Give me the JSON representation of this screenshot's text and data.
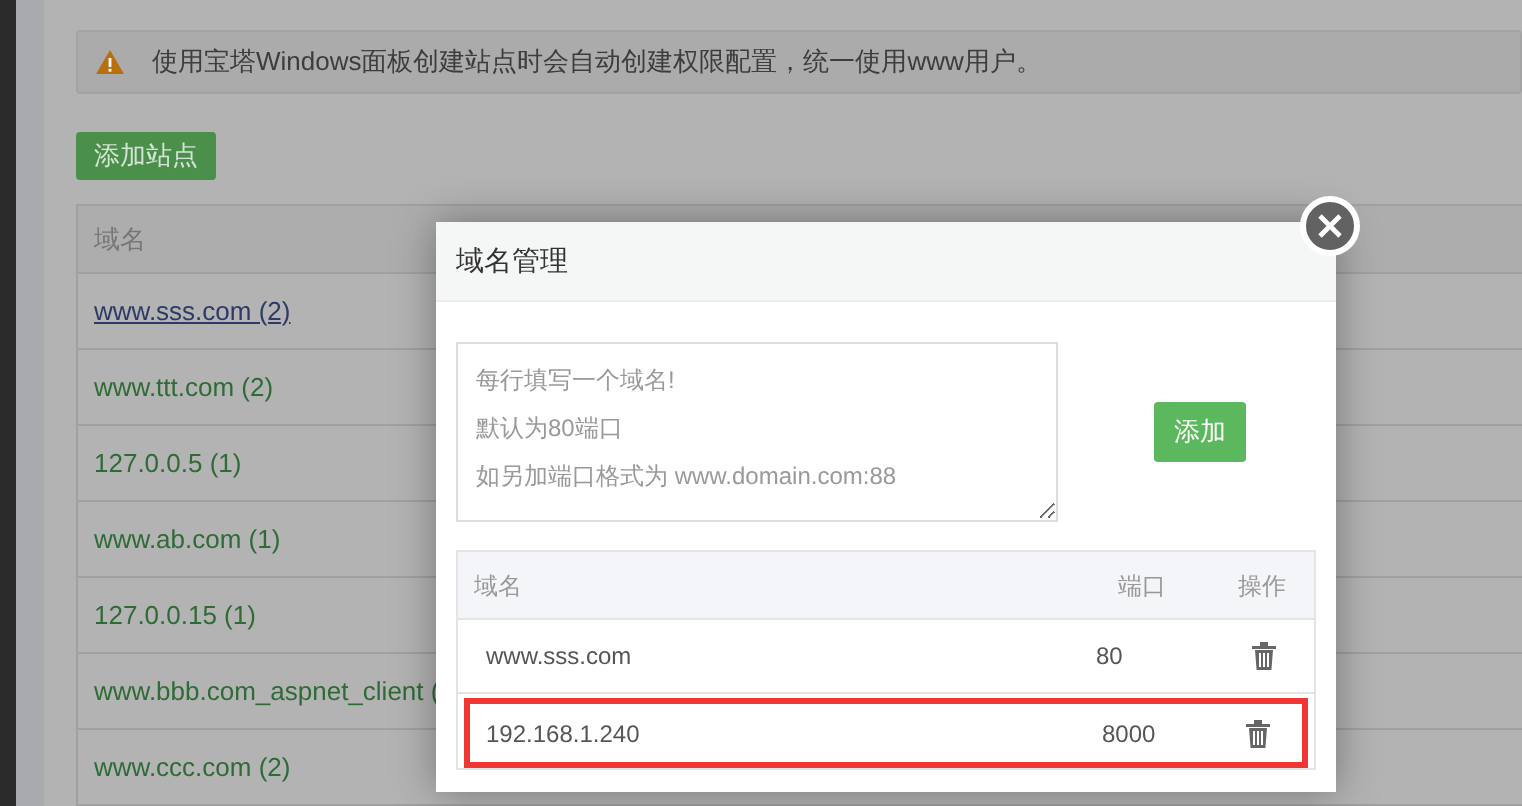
{
  "alert": {
    "text": "使用宝塔Windows面板创建站点时会自动创建权限配置，统一使用www用户。"
  },
  "add_site_button": "添加站点",
  "sites_table": {
    "columns": [
      "域名"
    ],
    "rows": [
      {
        "domain": "www.sss.com (2)",
        "hovered": true
      },
      {
        "domain": "www.ttt.com (2)",
        "hovered": false
      },
      {
        "domain": "127.0.0.5 (1)",
        "hovered": false
      },
      {
        "domain": "www.ab.com (1)",
        "hovered": false
      },
      {
        "domain": "127.0.0.15 (1)",
        "hovered": false
      },
      {
        "domain": "www.bbb.com_aspnet_client (",
        "hovered": false
      },
      {
        "domain": "www.ccc.com (2)",
        "hovered": false
      }
    ]
  },
  "dialog": {
    "title": "域名管理",
    "textarea": {
      "placeholder": [
        "每行填写一个域名!",
        "默认为80端口",
        "如另加端口格式为 www.domain.com:88"
      ]
    },
    "add_button": "添加",
    "columns": [
      "域名",
      "端口",
      "操作"
    ],
    "rows": [
      {
        "domain": "www.sss.com",
        "port": "80",
        "highlighted": false
      },
      {
        "domain": "192.168.1.240",
        "port": "8000",
        "highlighted": true
      }
    ]
  }
}
